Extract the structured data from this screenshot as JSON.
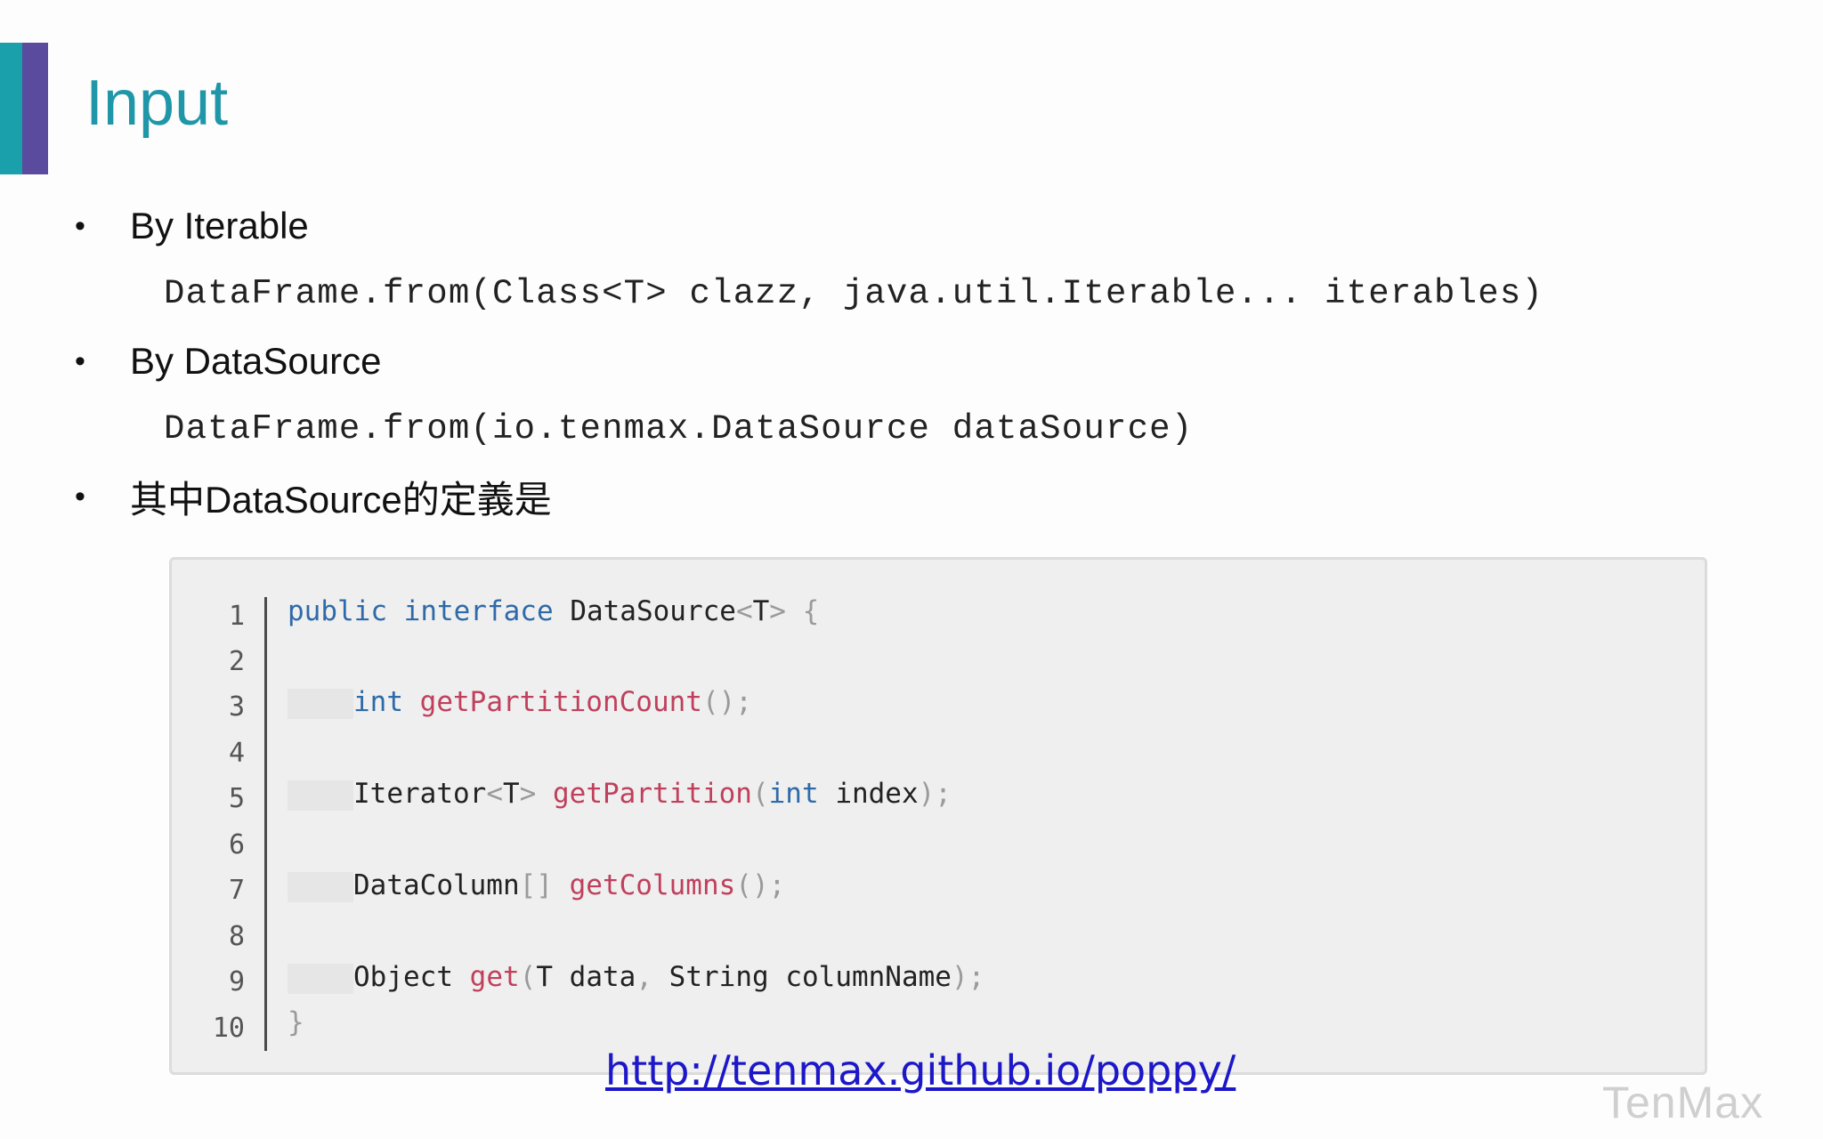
{
  "slide": {
    "title": "Input"
  },
  "bullets": [
    {
      "dot": "•",
      "text": "By Iterable",
      "signature": "DataFrame.from(Class<T> clazz, java.util.Iterable... iterables)"
    },
    {
      "dot": "•",
      "text": "By DataSource",
      "signature": "DataFrame.from(io.tenmax.DataSource dataSource)"
    },
    {
      "dot": "•",
      "text": "其中DataSource的定義是"
    }
  ],
  "code": {
    "line_numbers": [
      "1",
      "2",
      "3",
      "4",
      "5",
      "6",
      "7",
      "8",
      "9",
      "10"
    ],
    "lines": {
      "l1": {
        "kw1": "public",
        "kw2": "interface",
        "name": "DataSource",
        "lt": "<",
        "t": "T",
        "gt": ">",
        "brace": "{"
      },
      "l3": {
        "type": "int",
        "fn": "getPartitionCount",
        "punct": "();"
      },
      "l5": {
        "type": "Iterator",
        "lt": "<",
        "t": "T",
        "gt": ">",
        "fn": "getPartition",
        "open": "(",
        "ptype": "int",
        "pname": "index",
        "close": ");"
      },
      "l7": {
        "type": "DataColumn",
        "arr": "[]",
        "fn": "getColumns",
        "punct": "();"
      },
      "l9": {
        "type": "Object",
        "fn": "get",
        "open": "(",
        "p1type": "T",
        "p1name": "data",
        "comma": ",",
        "p2type": "String",
        "p2name": "columnName",
        "close": ");"
      },
      "l10": {
        "brace": "}"
      }
    }
  },
  "link": {
    "url_text": "http://tenmax.github.io/poppy/"
  },
  "watermark": {
    "text": "TenMax"
  },
  "colors": {
    "title": "#1f97a8",
    "accent_teal": "#1aa0ab",
    "accent_purple": "#5b4b9e",
    "keyword": "#2f6aa8",
    "method": "#c0405c",
    "link": "#1c17c8"
  }
}
